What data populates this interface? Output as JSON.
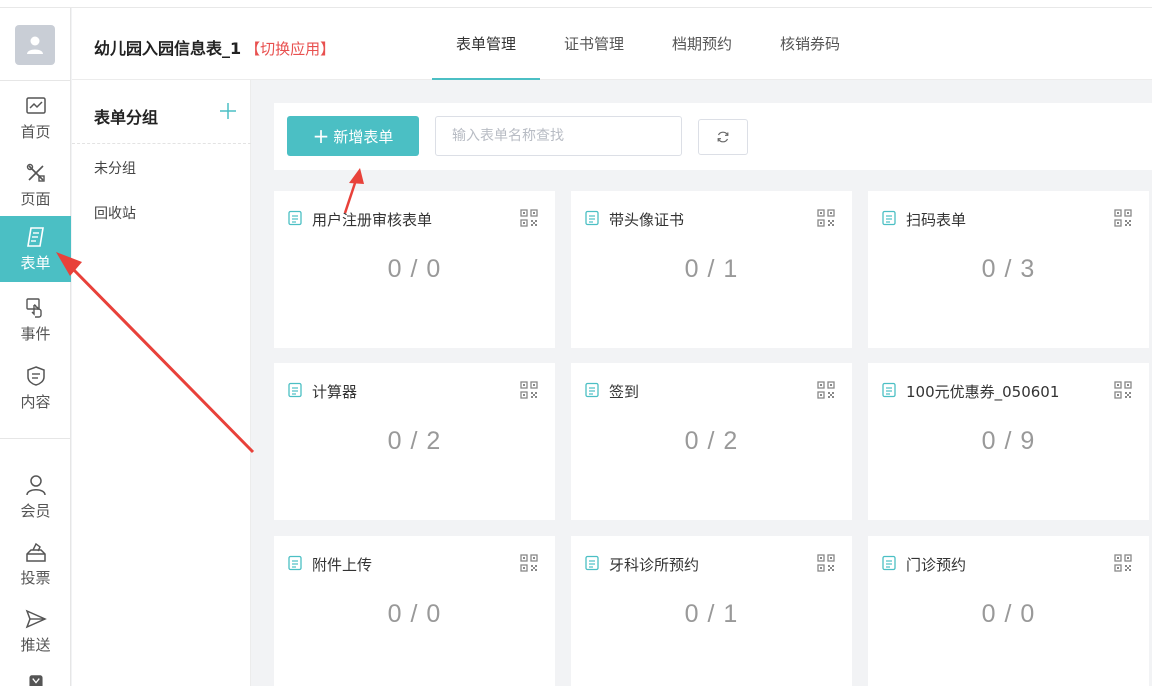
{
  "header": {
    "app_title": "幼儿园入园信息表_1",
    "switch_app": "【切换应用】",
    "tabs": [
      {
        "label": "表单管理",
        "active": true
      },
      {
        "label": "证书管理",
        "active": false
      },
      {
        "label": "档期预约",
        "active": false
      },
      {
        "label": "核销券码",
        "active": false
      }
    ]
  },
  "rail": {
    "items": [
      {
        "label": "首页",
        "icon": "chart-icon"
      },
      {
        "label": "页面",
        "icon": "tools-icon"
      },
      {
        "label": "表单",
        "icon": "form-icon",
        "active": true
      },
      {
        "label": "事件",
        "icon": "touch-icon"
      },
      {
        "label": "内容",
        "icon": "shield-doc-icon"
      },
      {
        "label": "会员",
        "icon": "user-icon"
      },
      {
        "label": "投票",
        "icon": "vote-icon"
      },
      {
        "label": "推送",
        "icon": "send-icon"
      }
    ]
  },
  "groups": {
    "title": "表单分组",
    "items": [
      "未分组",
      "回收站"
    ]
  },
  "toolbar": {
    "new_label": "新增表单",
    "search_placeholder": "输入表单名称查找"
  },
  "cards": [
    {
      "name": "用户注册审核表单",
      "count": "0 / 0"
    },
    {
      "name": "带头像证书",
      "count": "0 / 1"
    },
    {
      "name": "扫码表单",
      "count": "0 / 3"
    },
    {
      "name": "计算器",
      "count": "0 / 2"
    },
    {
      "name": "签到",
      "count": "0 / 2"
    },
    {
      "name": "100元优惠券_050601",
      "count": "0 / 9"
    },
    {
      "name": "附件上传",
      "count": "0 / 0"
    },
    {
      "name": "牙科诊所预约",
      "count": "0 / 1"
    },
    {
      "name": "门诊预约",
      "count": "0 / 0"
    }
  ],
  "colors": {
    "accent": "#4bbfc4",
    "switch_red": "#e8504f",
    "arrow_red": "#e8413a"
  }
}
